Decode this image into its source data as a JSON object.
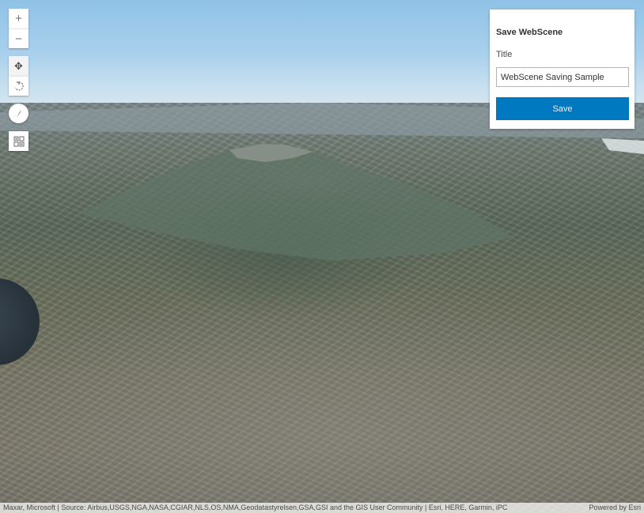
{
  "view": {
    "widgets": {
      "zoom_in": {
        "icon": "plus-icon",
        "glyph": "+"
      },
      "zoom_out": {
        "icon": "minus-icon",
        "glyph": "−"
      },
      "pan": {
        "icon": "pan-icon",
        "glyph": "✥"
      },
      "rotate": {
        "icon": "rotate-icon"
      },
      "compass": {
        "icon": "compass-icon"
      },
      "basemap_toggle": {
        "icon": "basemap-gallery-icon"
      }
    }
  },
  "save_panel": {
    "heading": "Save WebScene",
    "title_label": "Title",
    "title_value": "WebScene Saving Sample",
    "save_label": "Save"
  },
  "attribution": {
    "sources": "Maxar, Microsoft | Source: Airbus,USGS,NGA,NASA,CGIAR,NLS,OS,NMA,Geodatastyrelsen,GSA,GSI and the GIS User Community | Esri, HERE, Garmin, iPC",
    "powered_by": "Powered by Esri"
  },
  "colors": {
    "accent": "#0079c1",
    "panel_bg": "#ffffff"
  }
}
